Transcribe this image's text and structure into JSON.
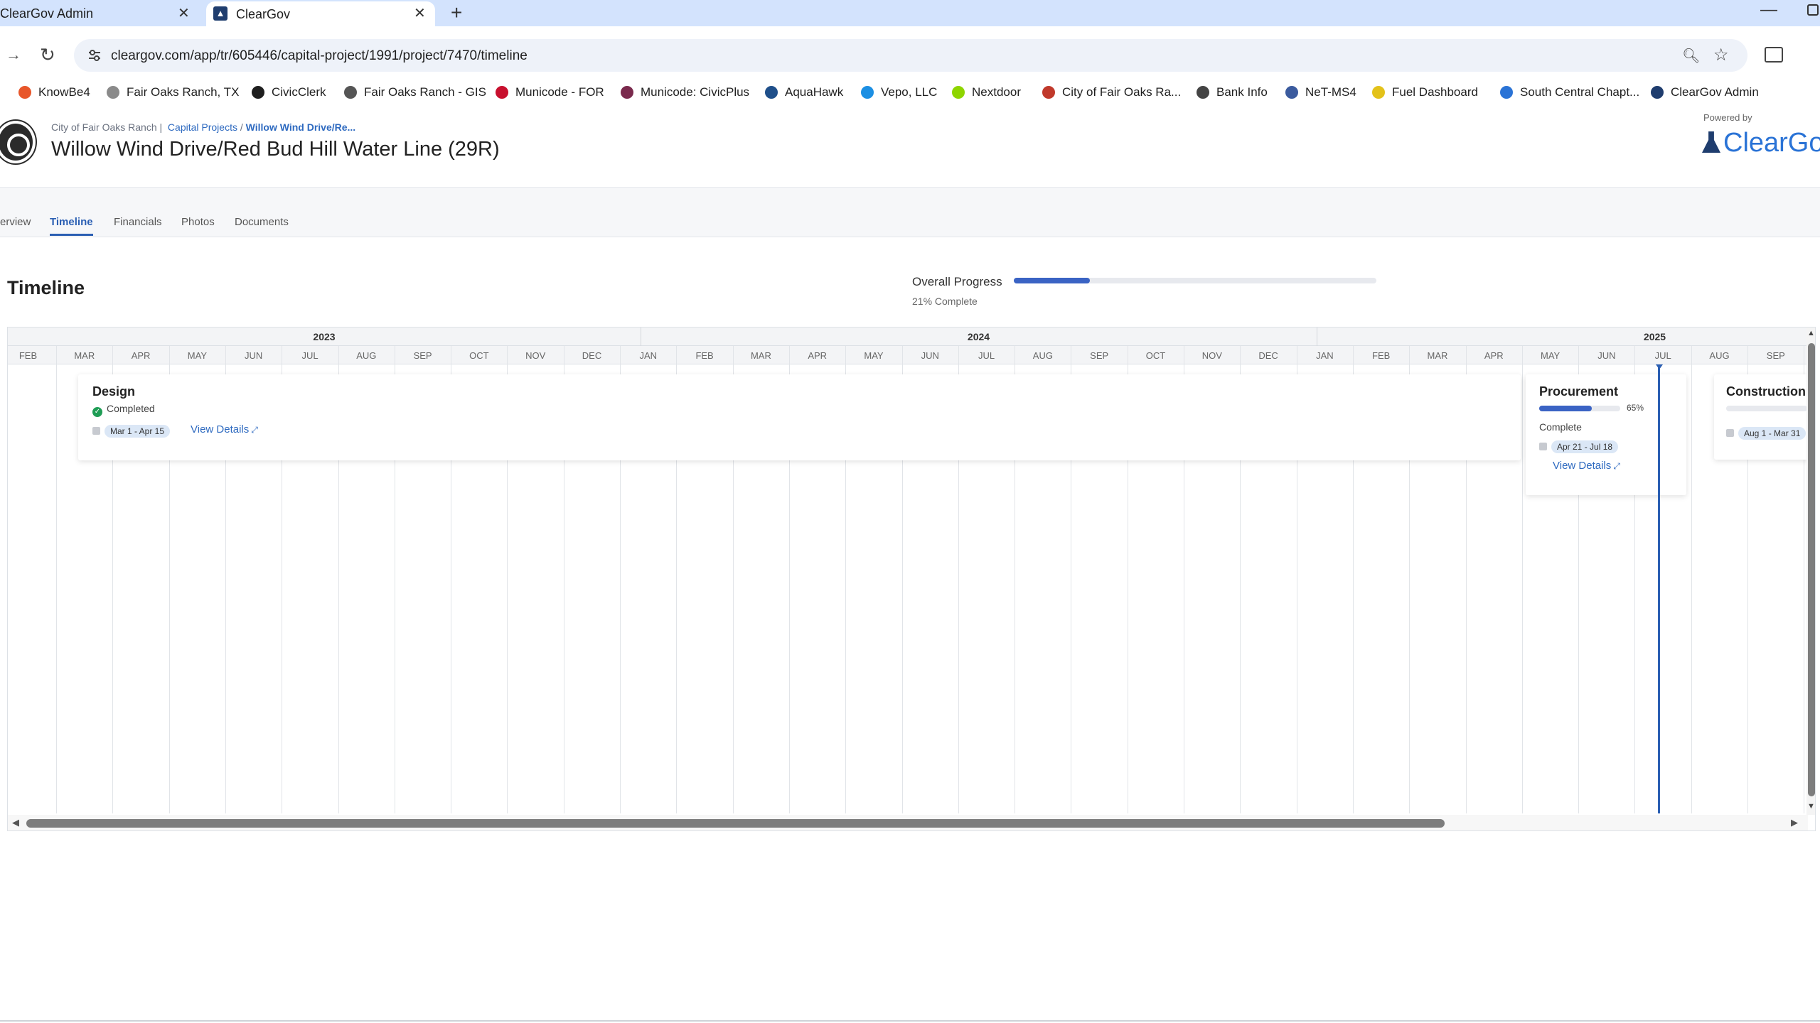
{
  "browser": {
    "tabs": [
      {
        "title": "ClearGov Admin"
      },
      {
        "title": "ClearGov"
      }
    ],
    "url": "cleargov.com/app/tr/605446/capital-project/1991/project/7470/timeline",
    "bookmarks": [
      {
        "label": "KnowBe4",
        "color": "#e8562a"
      },
      {
        "label": "Fair Oaks Ranch, TX",
        "color": "#8a8a8a"
      },
      {
        "label": "CivicClerk",
        "color": "#1f1f1f"
      },
      {
        "label": "Fair Oaks Ranch - GIS",
        "color": "#555555"
      },
      {
        "label": "Municode - FOR",
        "color": "#c8102e"
      },
      {
        "label": "Municode: CivicPlus",
        "color": "#7a2a4d"
      },
      {
        "label": "AquaHawk",
        "color": "#1f4f8a"
      },
      {
        "label": "Vepo, LLC",
        "color": "#1c8fe3"
      },
      {
        "label": "Nextdoor",
        "color": "#8ed500"
      },
      {
        "label": "City of Fair Oaks Ra...",
        "color": "#c0392b"
      },
      {
        "label": "Bank Info",
        "color": "#444444"
      },
      {
        "label": "NeT-MS4",
        "color": "#3b5b9e"
      },
      {
        "label": "Fuel Dashboard",
        "color": "#e3c21a"
      },
      {
        "label": "South Central Chapt...",
        "color": "#2a73d6"
      },
      {
        "label": "ClearGov Admin",
        "color": "#1f3d6e"
      }
    ]
  },
  "header": {
    "breadcrumb": {
      "org": "City of Fair Oaks Ranch",
      "section": "Capital Projects",
      "current": "Willow Wind Drive/Re..."
    },
    "title": "Willow Wind Drive/Red Bud Hill Water Line (29R)",
    "powered_by": "Powered by",
    "brand": "ClearGov"
  },
  "subnav": {
    "tabs": [
      "erview",
      "Timeline",
      "Financials",
      "Photos",
      "Documents"
    ],
    "active": "Timeline"
  },
  "timeline": {
    "heading": "Timeline",
    "overall_label": "Overall Progress",
    "overall_progress": 0.21,
    "overall_text": "21% Complete",
    "years": [
      "2023",
      "2024",
      "2025"
    ],
    "months": [
      "FEB",
      "MAR",
      "APR",
      "MAY",
      "JUN",
      "JUL",
      "AUG",
      "SEP",
      "OCT",
      "NOV",
      "DEC",
      "JAN",
      "FEB",
      "MAR",
      "APR",
      "MAY",
      "JUN",
      "JUL",
      "AUG",
      "SEP",
      "OCT",
      "NOV",
      "DEC",
      "JAN",
      "FEB",
      "MAR",
      "APR",
      "MAY",
      "JUN",
      "JUL",
      "AUG",
      "SEP"
    ],
    "phases": {
      "design": {
        "title": "Design",
        "status": "Completed",
        "dates": "Mar 1 - Apr 15",
        "link": "View Details"
      },
      "procurement": {
        "title": "Procurement",
        "progress": 0.65,
        "pct": "65%",
        "status": "Complete",
        "dates": "Apr 21 - Jul 18",
        "link": "View Details"
      },
      "construction": {
        "title": "Construction",
        "dates": "Aug 1 - Mar 31"
      }
    }
  }
}
